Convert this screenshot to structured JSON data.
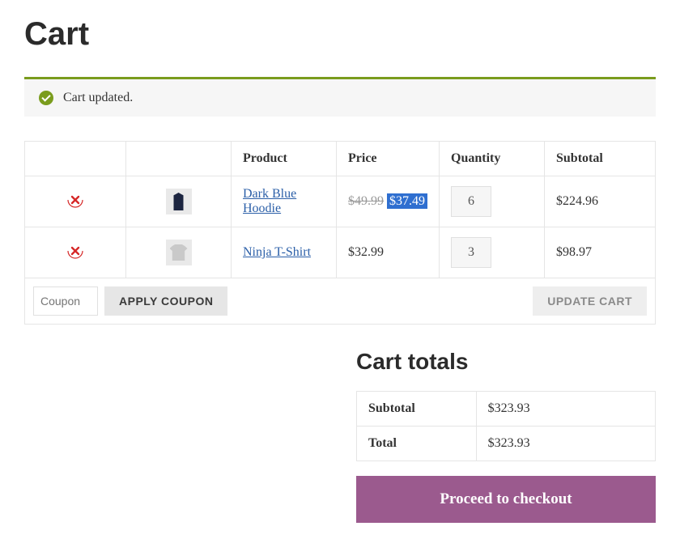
{
  "page": {
    "title": "Cart"
  },
  "notice": {
    "message": "Cart updated."
  },
  "table": {
    "headers": {
      "product": "Product",
      "price": "Price",
      "quantity": "Quantity",
      "subtotal": "Subtotal"
    },
    "rows": [
      {
        "name": "Dark Blue Hoodie",
        "original_price": "$49.99",
        "sale_price": "$37.49",
        "quantity": "6",
        "subtotal": "$224.96"
      },
      {
        "name": "Ninja T-Shirt",
        "price": "$32.99",
        "quantity": "3",
        "subtotal": "$98.97"
      }
    ],
    "coupon_placeholder": "Coupon",
    "apply_coupon_label": "APPLY COUPON",
    "update_cart_label": "UPDATE CART"
  },
  "totals": {
    "title": "Cart totals",
    "subtotal_label": "Subtotal",
    "subtotal_value": "$323.93",
    "total_label": "Total",
    "total_value": "$323.93"
  },
  "checkout": {
    "label": "Proceed to checkout"
  }
}
